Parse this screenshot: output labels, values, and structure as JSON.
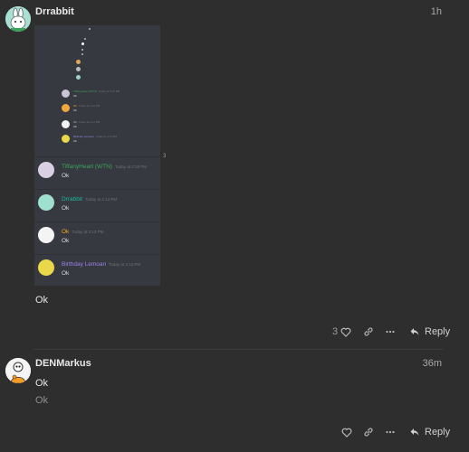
{
  "posts": [
    {
      "username": "Drrabbit",
      "time": "1h",
      "text": "Ok",
      "like_count": "3",
      "reply_label": "Reply"
    },
    {
      "username": "DENMarkus",
      "time": "36m",
      "text": "Ok",
      "quote_text": "Ok",
      "reply_label": "Reply"
    }
  ],
  "embed": {
    "side_marker": "3",
    "preview_rows": [
      {
        "name": "TiffanyHeart (WTN)",
        "time": "Today at 2:15 PM",
        "text": "Ok",
        "color": "#3ba55c"
      },
      {
        "name": "Ok",
        "time": "Today at 2:13 PM",
        "text": "Ok",
        "color": "#faa61a"
      },
      {
        "name": "Ok",
        "time": "Today at 2:13 PM",
        "text": "Ok",
        "color": "#b9bbbe"
      },
      {
        "name": "Birthday Lemoan",
        "time": "Today at 2:13 PM",
        "text": "Ok",
        "color": "#9b84ee"
      }
    ],
    "messages": [
      {
        "name": "TiffanyHeart (WTN)",
        "time": "Today at 2:15 PM",
        "text": "Ok",
        "color": "#3ba55c"
      },
      {
        "name": "Drrabbit",
        "time": "Today at 2:12 PM",
        "text": "Ok",
        "color": "#1abc9c"
      },
      {
        "name": "Ok",
        "time": "Today at 2:13 PM",
        "text": "Ok",
        "color": "#faa61a"
      },
      {
        "name": "Birthday Lemoan",
        "time": "Today at 3:13 PM",
        "text": "Ok",
        "color": "#9b84ee"
      }
    ]
  },
  "icons": {
    "like": "heart-icon",
    "link": "link-icon",
    "more": "ellipsis-icon",
    "reply": "reply-arrow-icon"
  }
}
